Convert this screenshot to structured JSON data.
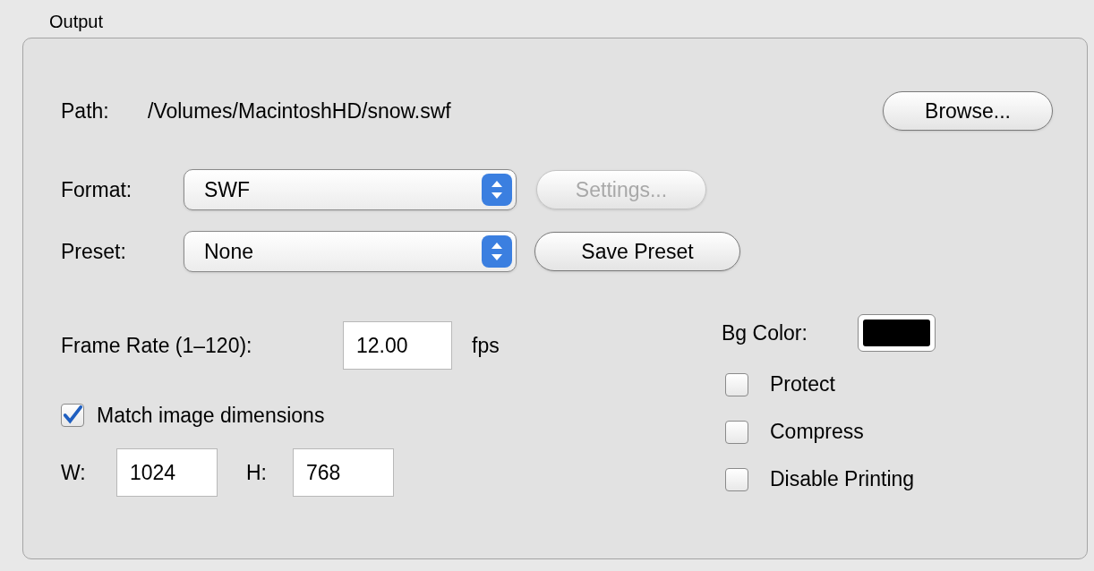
{
  "section": {
    "title": "Output"
  },
  "path": {
    "label": "Path:",
    "value": "/Volumes/MacintoshHD/snow.swf",
    "button": "Browse..."
  },
  "format": {
    "label": "Format:",
    "value": "SWF",
    "button": {
      "label": "Settings...",
      "disabled": true
    }
  },
  "preset": {
    "label": "Preset:",
    "value": "None",
    "button": {
      "label": "Save Preset",
      "disabled": false
    }
  },
  "frame_rate": {
    "label": "Frame Rate (1–120):",
    "value": "12.00",
    "unit": "fps"
  },
  "match_dimensions": {
    "label": "Match image dimensions",
    "checked": true
  },
  "width": {
    "label": "W:",
    "value": "1024"
  },
  "height": {
    "label": "H:",
    "value": "768"
  },
  "bg_color": {
    "label": "Bg Color:",
    "color": "#000000"
  },
  "options": [
    {
      "label": "Protect",
      "checked": false
    },
    {
      "label": "Compress",
      "checked": false
    },
    {
      "label": "Disable Printing",
      "checked": false
    }
  ]
}
